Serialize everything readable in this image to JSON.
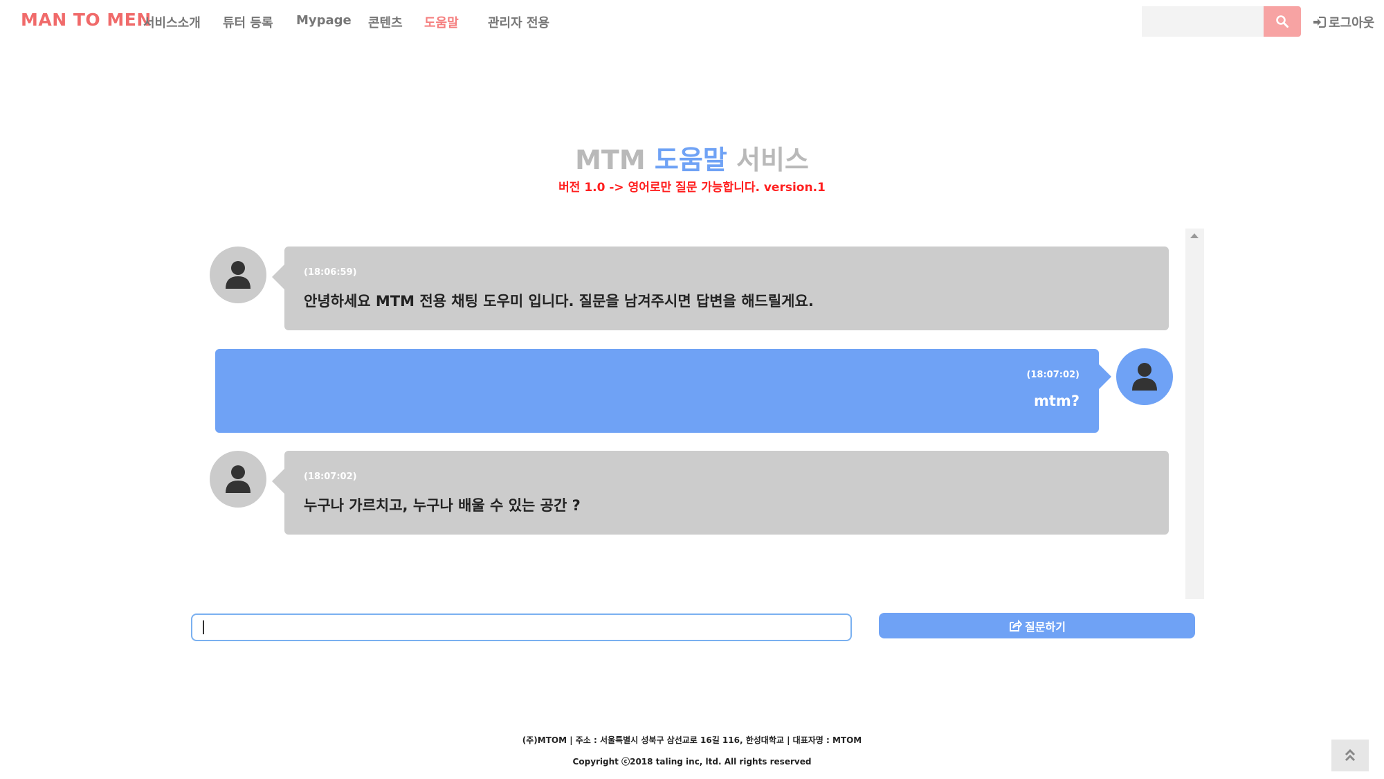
{
  "navbar": {
    "brand": "MAN TO MEN",
    "items": [
      {
        "label": "서비스소개",
        "active": false
      },
      {
        "label": "튜터 등록",
        "active": false
      },
      {
        "label": "Mypage",
        "active": false
      },
      {
        "label": "콘텐츠",
        "active": false
      },
      {
        "label": "도움말",
        "active": true
      },
      {
        "label": "관리자 전용",
        "active": false
      }
    ],
    "search_value": "",
    "search_icon": "search-icon",
    "logout_label": "로그아웃",
    "logout_icon": "sign-in-icon"
  },
  "header": {
    "title_part1": "MTM",
    "title_part2": "도움말",
    "title_part3": "서비스",
    "subtitle": "버전 1.0 -> 영어로만 질문 가능합니다.  version.1"
  },
  "chat": {
    "messages": [
      {
        "sender": "bot",
        "time": "(18:06:59)",
        "text": "안녕하세요 MTM 전용 채팅 도우미 입니다. 질문을 남겨주시면 답변을 해드릴게요."
      },
      {
        "sender": "user",
        "time": "(18:07:02)",
        "text": "mtm?"
      },
      {
        "sender": "bot",
        "time": "(18:07:02)",
        "text": "누구나 가르치고, 누구나 배울 수 있는 공간 ?"
      }
    ],
    "input_value": "",
    "ask_label": "질문하기",
    "ask_icon": "share-icon"
  },
  "footer": {
    "line1": "(주)MTOM | 주소 : 서울특별시 성북구 삼선교로 16길 116, 한성대학교 | 대표자명 : MTOM",
    "line2": "Copyright ⓒ2018 taling inc, ltd. All rights reserved",
    "top_icon": "double-chevron-up-icon"
  },
  "colors": {
    "brand": "#f06a6a",
    "accent_blue": "#6fa2f5",
    "bot_bubble": "#cccccc",
    "warning_red": "#ff1f1f"
  }
}
